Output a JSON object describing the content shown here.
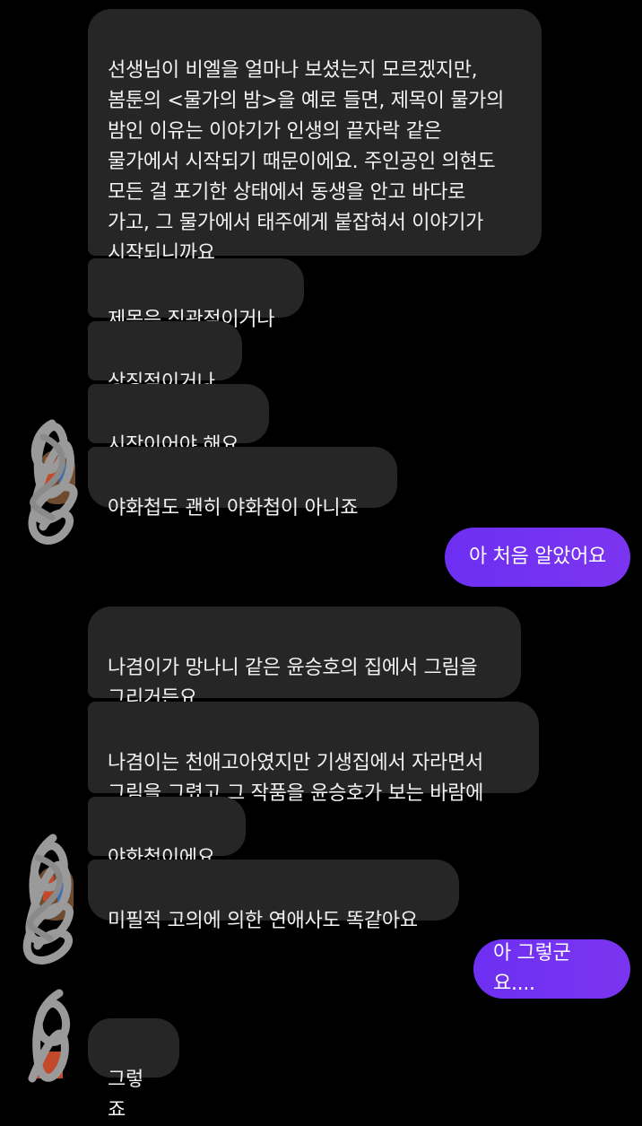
{
  "messages": [
    {
      "side": "received",
      "text": "선생님이 비엘을 얼마나 보셨는지 모르겠지만,\n봄툰의 <물가의 밤>을 예로 들면, 제목이 물가의\n밤인 이유는 이야기가 인생의 끝자락 같은\n물가에서 시작되기 때문이에요. 주인공인 의현도\n모든 걸 포기한 상태에서 동생을 안고 바다로\n가고, 그 물가에서 태주에게 붙잡혀서 이야기가\n시작되니까요"
    },
    {
      "side": "received",
      "text": "제목은 직관적이거나"
    },
    {
      "side": "received",
      "text": "상징적이거나"
    },
    {
      "side": "received",
      "text": "시작이어야 해요"
    },
    {
      "side": "received",
      "text": "야화첩도 괜히 야화첩이 아니죠"
    },
    {
      "side": "sent",
      "text": "아 처음 알았어요"
    },
    {
      "side": "received",
      "text": "나겸이가 망나니 같은 윤승호의 집에서 그림을\n그리거든요"
    },
    {
      "side": "received",
      "text": "나겸이는 천애고아였지만 기생집에서 자라면서\n그림을 그렸고 그 작품을 윤승호가 보는 바람에"
    },
    {
      "side": "received",
      "text": "야화첩이에요"
    },
    {
      "side": "received",
      "text": "미필적 고의에 의한 연애사도 똑같아요"
    },
    {
      "side": "sent",
      "text": "아 그렇군요...."
    },
    {
      "side": "received",
      "text": "그렇죠"
    }
  ],
  "colors": {
    "background": "#000000",
    "received_bubble": "#262626",
    "sent_bubble": "#6d2ff2",
    "avatar_scribble": "#8e8e8e"
  },
  "icons": [
    "scribbled-avatar-icon"
  ]
}
